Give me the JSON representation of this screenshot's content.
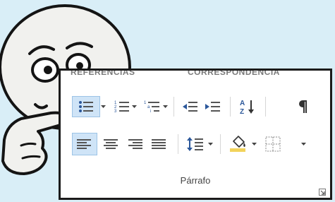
{
  "ribbon": {
    "tabs": [
      "REFERENCIAS",
      "CORRESPONDENCIA"
    ],
    "group_label": "Párrafo"
  },
  "icons": {
    "bullets": "bullets-icon",
    "numbering": "numbering-icon",
    "multilevel": "multilevel-list-icon",
    "decrease_indent": "decrease-indent-icon",
    "increase_indent": "increase-indent-icon",
    "sort": "sort-icon",
    "show_marks": "pilcrow-icon",
    "align_left": "align-left-icon",
    "center": "align-center-icon",
    "align_right": "align-right-icon",
    "justify": "justify-icon",
    "line_spacing": "line-spacing-icon",
    "shading": "shading-icon",
    "borders": "borders-icon",
    "launcher": "dialog-launcher-icon"
  },
  "colors": {
    "accent": "#2b579a",
    "selected_bg": "#cfe4f7",
    "shading_fill": "#f2d35c"
  }
}
